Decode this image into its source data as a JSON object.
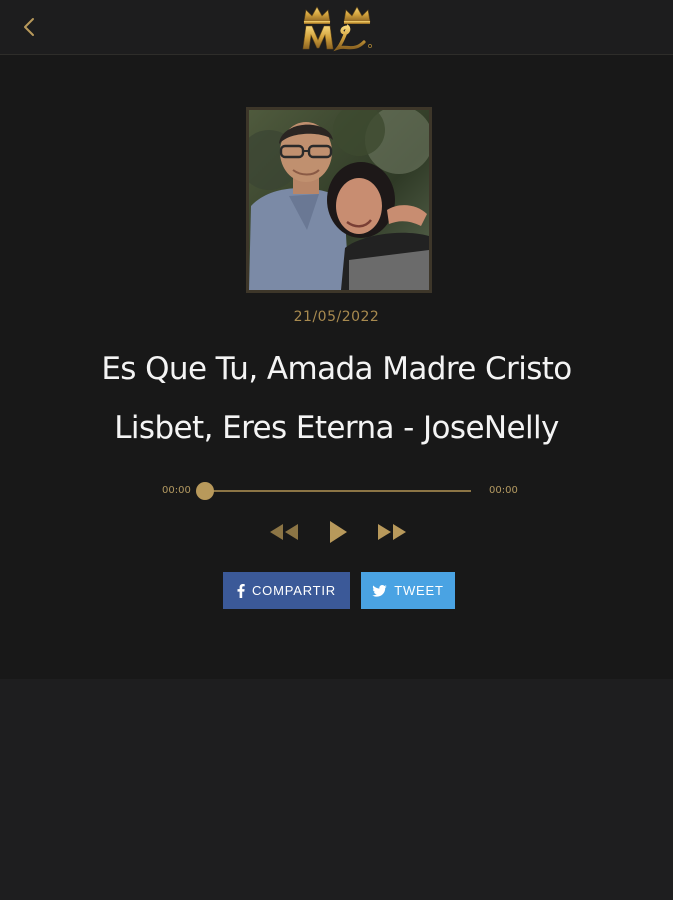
{
  "header": {
    "back_icon": "chevron-left-icon",
    "logo_text": "ML",
    "logo_icon": "crown-logo"
  },
  "memorial": {
    "photo_icon": "couple-photo",
    "date": "21/05/2022",
    "title": "Es Que Tu, Amada Madre Cristo Lisbet, Eres Eterna - JoseNelly"
  },
  "player": {
    "current_time": "00:00",
    "duration": "00:00",
    "progress": 0,
    "rewind_icon": "rewind-icon",
    "play_icon": "play-icon",
    "forward_icon": "fast-forward-icon"
  },
  "share": {
    "facebook_label": "COMPARTIR",
    "facebook_icon": "facebook-icon",
    "twitter_label": "TWEET",
    "twitter_icon": "twitter-icon"
  },
  "colors": {
    "accent_gold": "#b8995b",
    "background": "#181818",
    "facebook": "#3b5998",
    "twitter": "#4aa3e3"
  }
}
